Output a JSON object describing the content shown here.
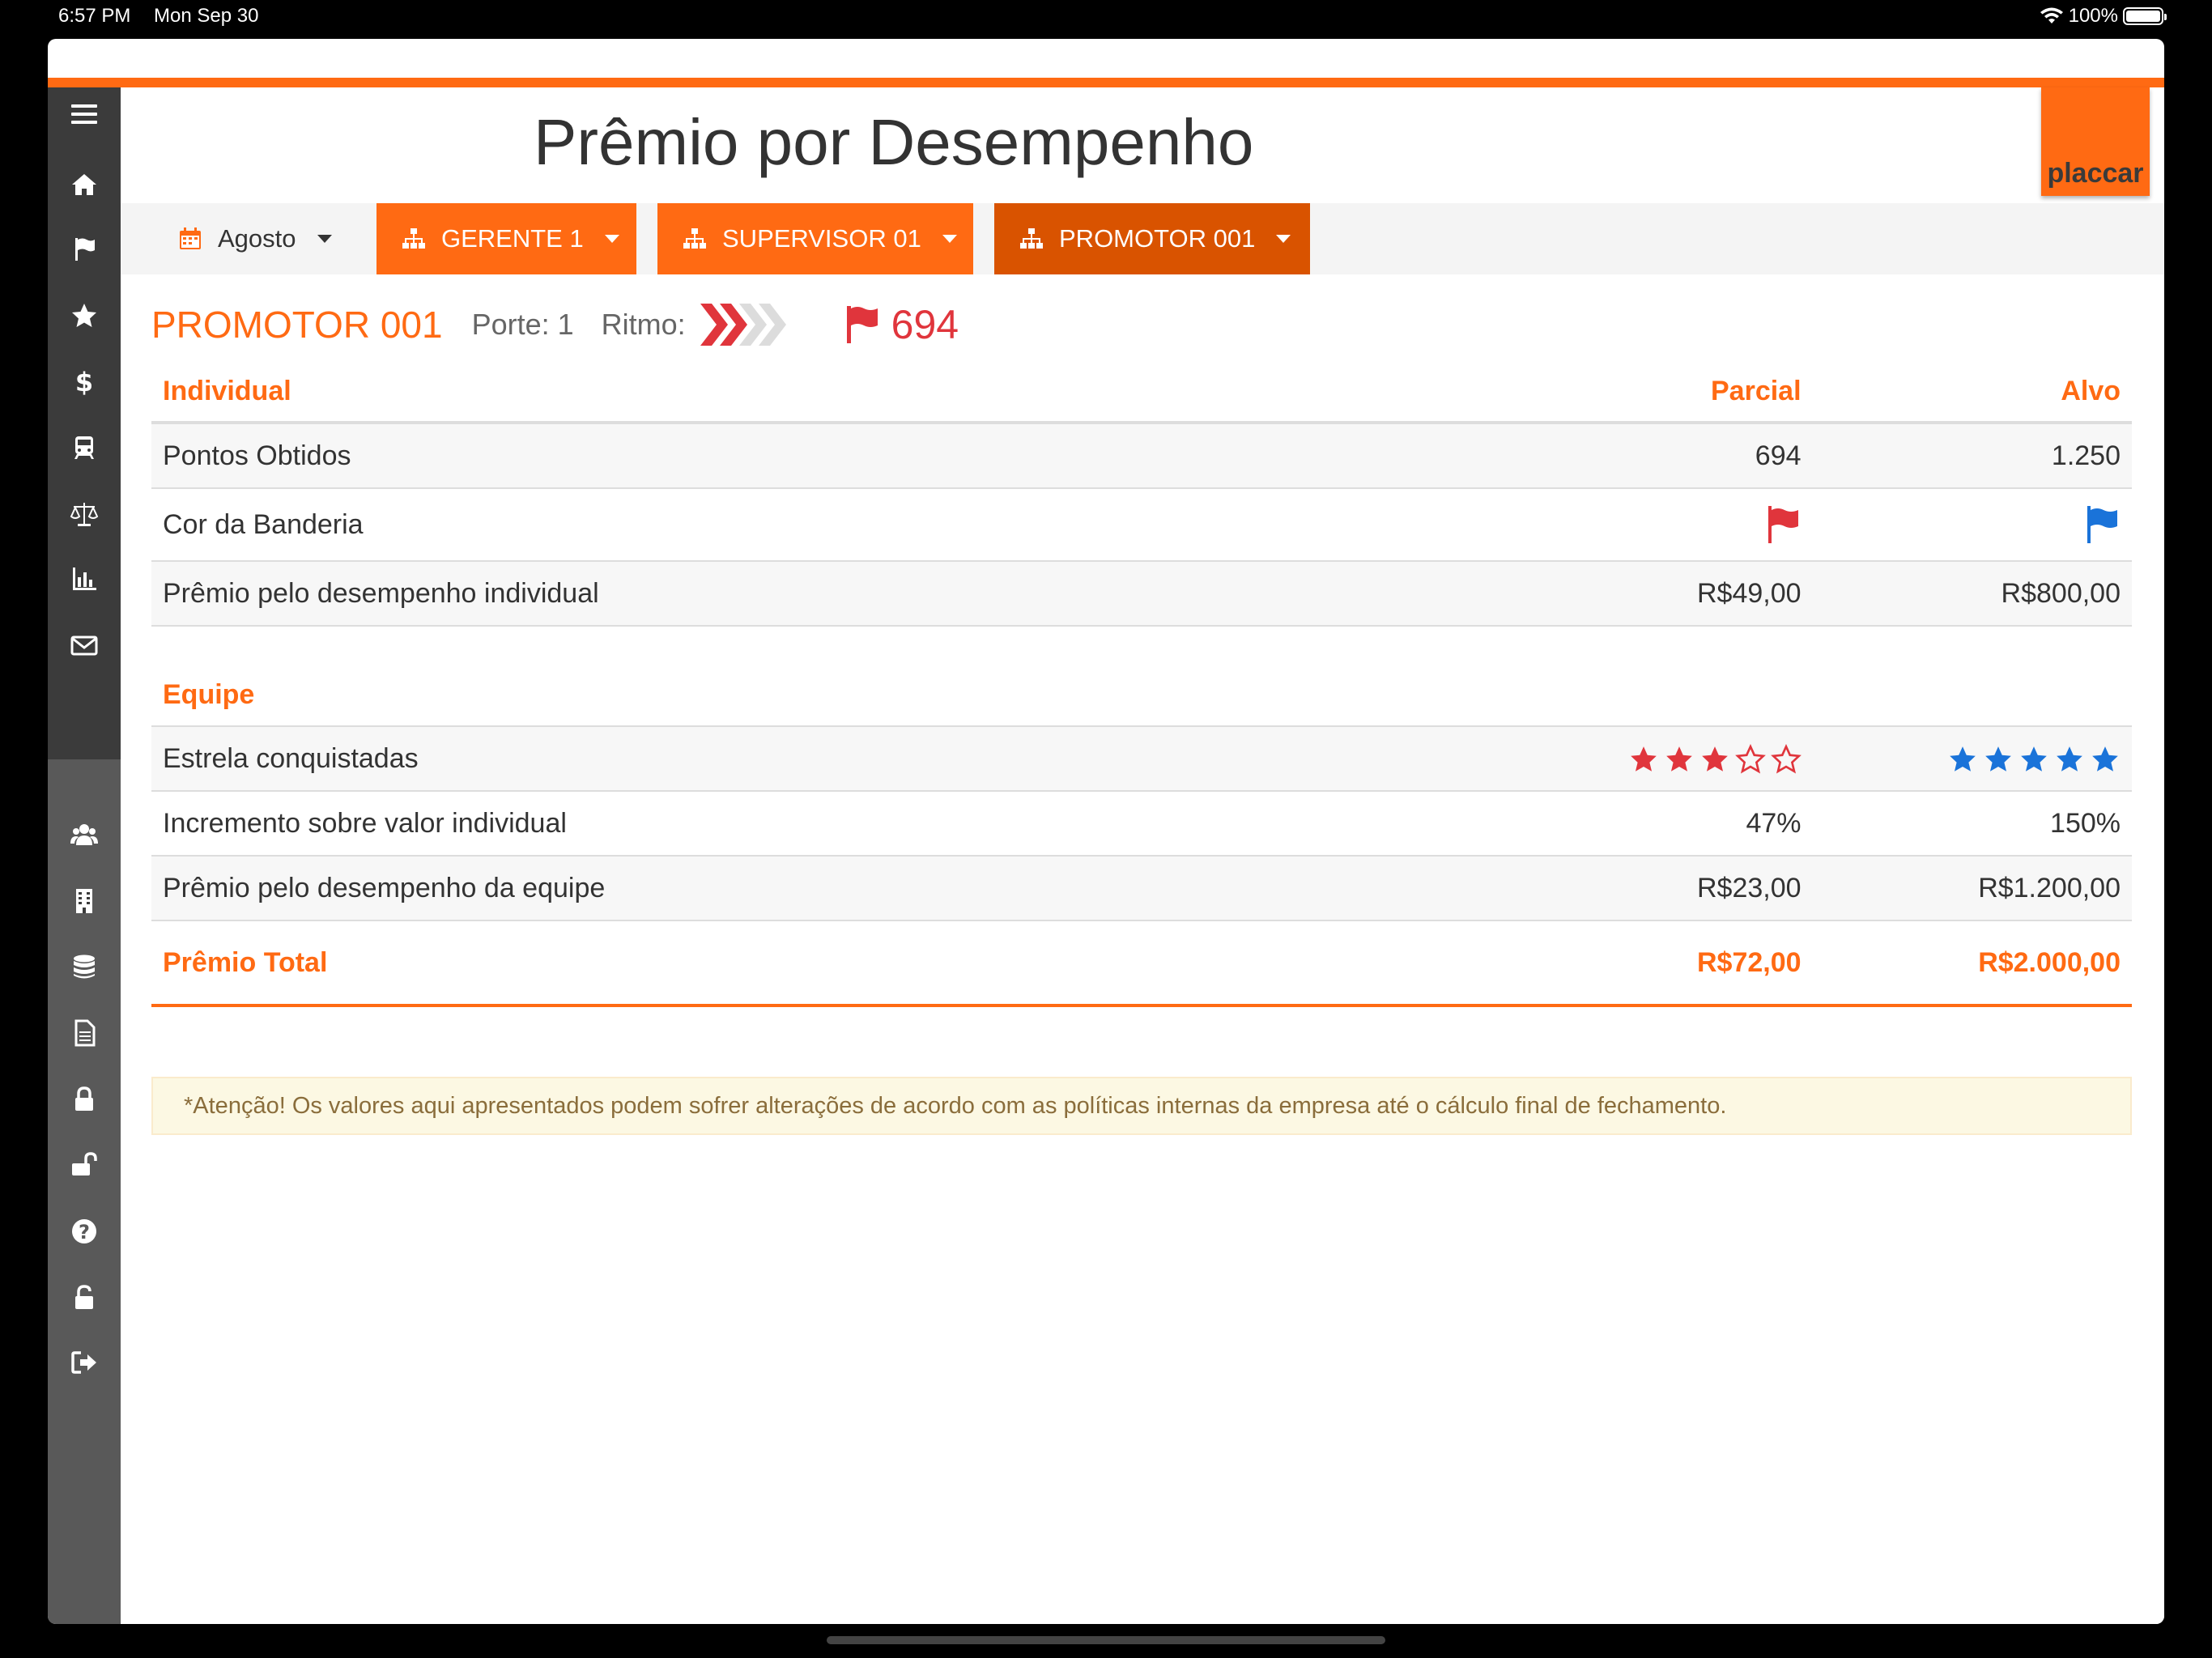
{
  "status_bar": {
    "time": "6:57 PM",
    "date": "Mon Sep 30",
    "battery": "100%"
  },
  "header": {
    "title": "Prêmio por Desempenho",
    "logo_text": "placcar"
  },
  "theme": {
    "accent": "#ff6a13",
    "accent_dark": "#d95300",
    "red": "#e0353c",
    "blue": "#1a73d9",
    "sidebar": "#3b3b3b"
  },
  "sidebar": {
    "items": [
      {
        "icon": "hamburger-icon"
      },
      {
        "icon": "home-icon"
      },
      {
        "icon": "flag-icon"
      },
      {
        "icon": "star-icon"
      },
      {
        "icon": "dollar-icon"
      },
      {
        "icon": "train-icon"
      },
      {
        "icon": "balance-scale-icon"
      },
      {
        "icon": "bar-chart-icon"
      },
      {
        "icon": "envelope-icon"
      },
      {
        "icon": "users-icon"
      },
      {
        "icon": "building-icon"
      },
      {
        "icon": "database-icon"
      },
      {
        "icon": "document-icon"
      },
      {
        "icon": "lock-icon"
      },
      {
        "icon": "unlock-icon"
      },
      {
        "icon": "help-icon"
      },
      {
        "icon": "unlock-alt-icon"
      },
      {
        "icon": "sign-out-icon"
      }
    ]
  },
  "filters": {
    "month": "Agosto",
    "manager": "GERENTE 1",
    "supervisor": "SUPERVISOR 01",
    "promoter": "PROMOTOR 001"
  },
  "promoter": {
    "name": "PROMOTOR 001",
    "porte": "Porte: 1",
    "ritmo_label": "Ritmo:",
    "ritmo_level": 2,
    "ritmo_max": 4,
    "score": "694"
  },
  "table": {
    "individual_header": "Individual",
    "col_parcial": "Parcial",
    "col_alvo": "Alvo",
    "rows_individual": [
      {
        "label": "Pontos Obtidos",
        "parcial": "694",
        "alvo": "1.250"
      },
      {
        "label": "Cor da Banderia",
        "parcial_flag": "red",
        "alvo_flag": "blue"
      },
      {
        "label": "Prêmio pelo desempenho individual",
        "parcial": "R$49,00",
        "alvo": "R$800,00"
      }
    ],
    "equipe_header": "Equipe",
    "stars_row": {
      "label": "Estrela conquistadas",
      "parcial_stars": 3,
      "alvo_stars": 5,
      "max_stars": 5
    },
    "rows_equipe": [
      {
        "label": "Incremento sobre valor individual",
        "parcial": "47%",
        "alvo": "150%"
      },
      {
        "label": "Prêmio pelo desempenho da equipe",
        "parcial": "R$23,00",
        "alvo": "R$1.200,00"
      }
    ],
    "total": {
      "label": "Prêmio Total",
      "parcial": "R$72,00",
      "alvo": "R$2.000,00"
    }
  },
  "notice": "*Atenção! Os valores aqui apresentados podem sofrer alterações de acordo com as políticas internas da empresa até o cálculo final de fechamento."
}
